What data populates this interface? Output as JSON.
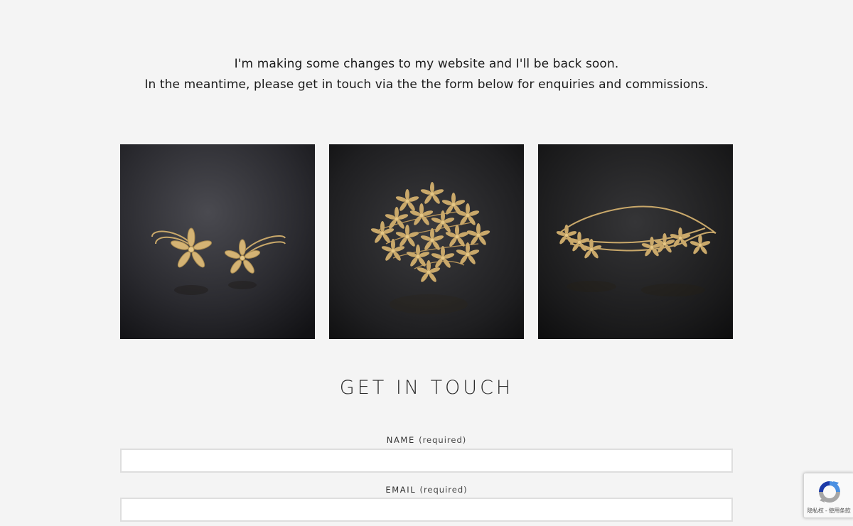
{
  "intro": {
    "line1": "I'm making some changes to my website and I'll be back soon.",
    "line2": "In the meantime, please get in touch via the the form below for enquiries and commissions."
  },
  "gallery": {
    "images": [
      {
        "icon": "jewellery-hairpins-image"
      },
      {
        "icon": "jewellery-hair-comb-image"
      },
      {
        "icon": "jewellery-tiara-image"
      }
    ]
  },
  "contact": {
    "heading": "GET IN TOUCH",
    "name_label": "NAME",
    "name_required": "(required)",
    "name_value": "",
    "email_label": "EMAIL",
    "email_required": "(required)",
    "email_value": ""
  },
  "recaptcha": {
    "terms": "隐私权 - 使用条款",
    "icon": "recaptcha-logo-icon"
  },
  "colors": {
    "background": "#f4f4f4",
    "text": "#1c1c1c",
    "input_border": "#dedede",
    "gold": "#c9a86a",
    "stone": "#9aa77a"
  }
}
